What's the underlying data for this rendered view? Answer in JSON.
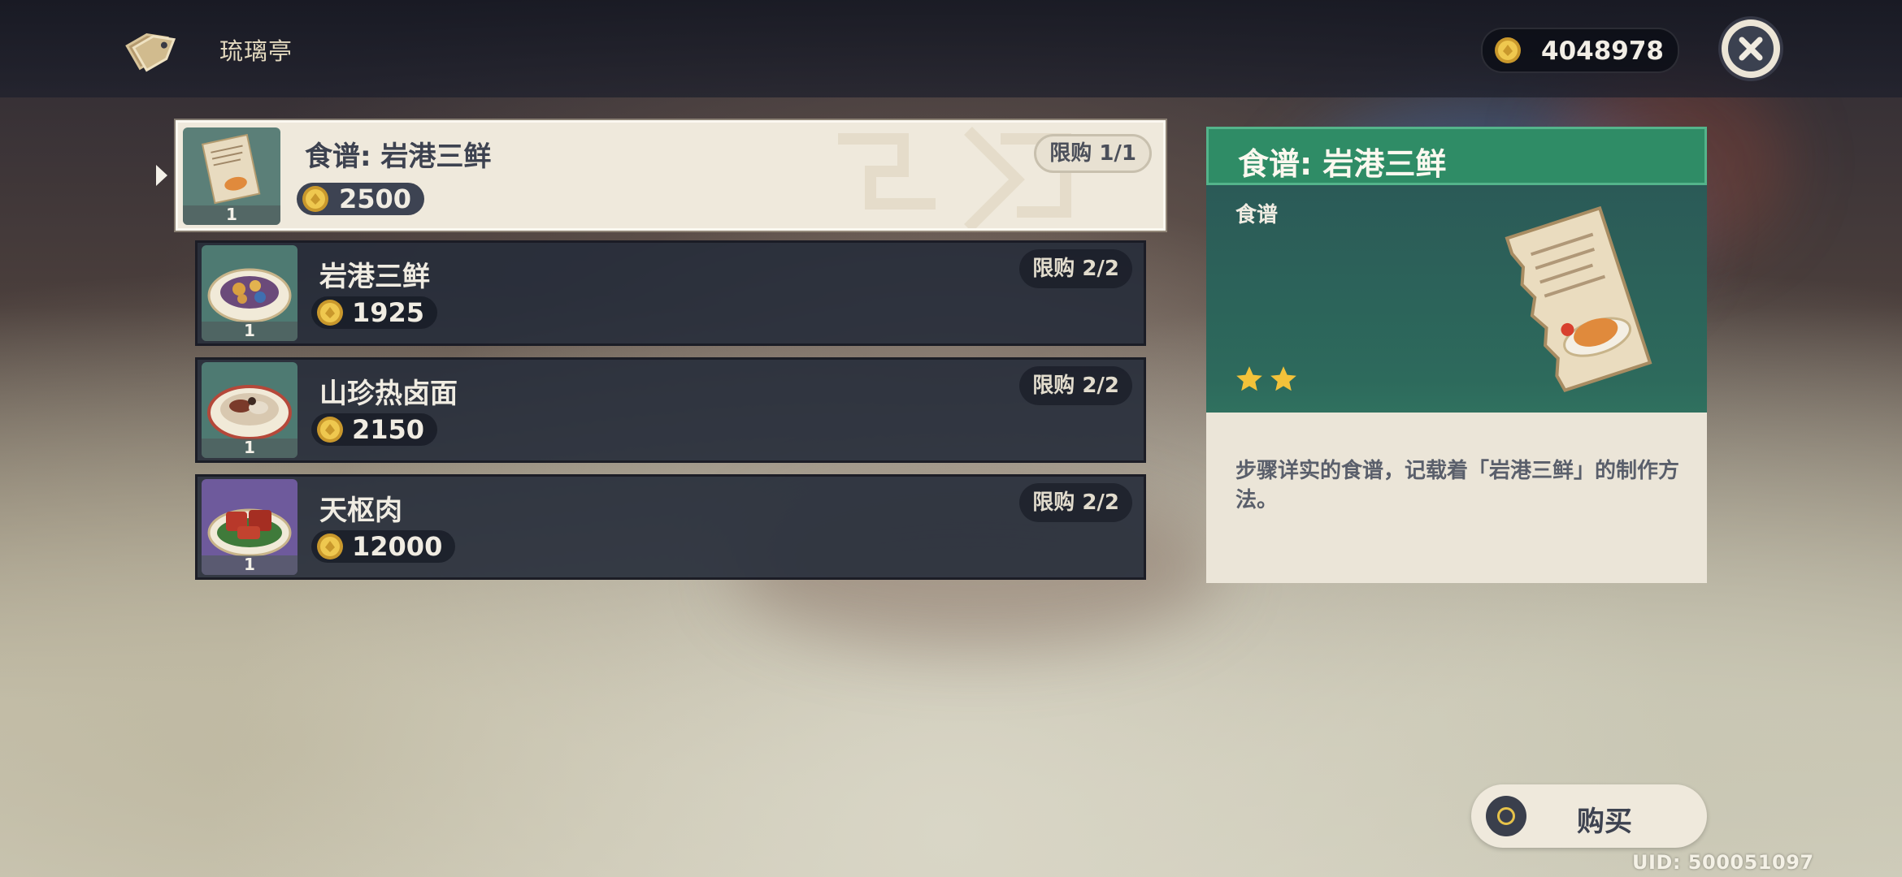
{
  "shop": {
    "name": "琉璃亭",
    "icon": "price-tag-icon"
  },
  "currency": {
    "icon": "mora-coin-icon",
    "amount": "4048978"
  },
  "close": {
    "icon": "close-icon"
  },
  "items": [
    {
      "name": "食谱: 岩港三鲜",
      "price": "2500",
      "limit": "限购 1/1",
      "count": "1",
      "icon": "recipe-scroll-icon",
      "selected": true
    },
    {
      "name": "岩港三鲜",
      "price": "1925",
      "limit": "限购 2/2",
      "count": "1",
      "icon": "seafood-dish-icon",
      "selected": false
    },
    {
      "name": "山珍热卤面",
      "price": "2150",
      "limit": "限购 2/2",
      "count": "1",
      "icon": "noodle-dish-icon",
      "selected": false
    },
    {
      "name": "天枢肉",
      "price": "12000",
      "limit": "限购 2/2",
      "count": "1",
      "icon": "braised-pork-dish-icon",
      "selected": false
    }
  ],
  "detail": {
    "title": "食谱: 岩港三鲜",
    "category": "食谱",
    "rarity": 2,
    "description": "步骤详实的食谱，记载着「岩港三鲜」的制作方法。",
    "art": "recipe-scroll-art"
  },
  "purchase": {
    "label": "购买",
    "icon": "gamepad-circle-button-icon"
  },
  "uid": "UID: 500051097",
  "colors": {
    "header_green": "#2f8c66",
    "coin_gold": "#e6b93a",
    "panel_cream": "#efe9dc",
    "row_dark": "#262c3a"
  }
}
